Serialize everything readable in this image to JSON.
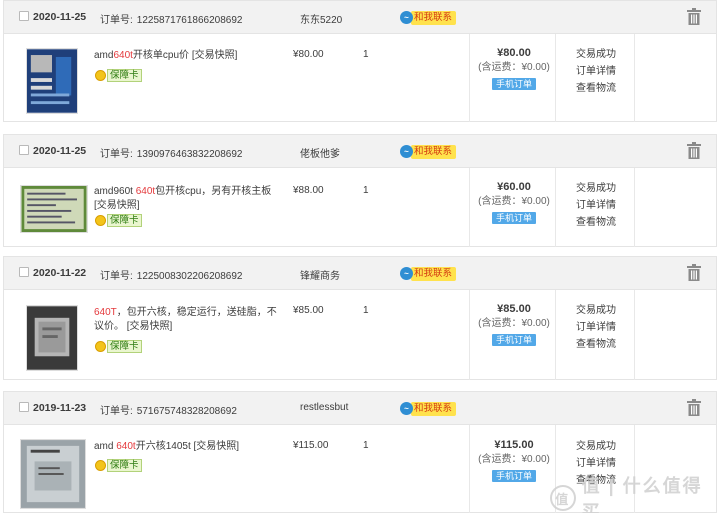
{
  "orders": [
    {
      "date": "2020-11-25",
      "order_label": "订单号:",
      "order_no": "1225871761866208692",
      "shop": "东东5220",
      "contact": "和我联系",
      "title_pre": "amd",
      "title_hl": "640t",
      "title_post": "开核单cpu价 [交易快照]",
      "badge": "保障卡",
      "price": "¥80.00",
      "qty": "1",
      "total": "¥80.00",
      "shipping": "(含运费：¥0.00)",
      "mobile": "手机订单",
      "actions": [
        "交易成功",
        "订单详情",
        "查看物流"
      ]
    },
    {
      "date": "2020-11-25",
      "order_label": "订单号:",
      "order_no": "1390976463832208692",
      "shop": "佬板他爹",
      "contact": "和我联系",
      "title_pre": "amd960t ",
      "title_hl": "640t",
      "title_post": "包开核cpu，另有开核主板 [交易快照]",
      "badge": "保障卡",
      "price": "¥88.00",
      "qty": "1",
      "total": "¥60.00",
      "shipping": "(含运费：¥0.00)",
      "mobile": "手机订单",
      "actions": [
        "交易成功",
        "订单详情",
        "查看物流"
      ]
    },
    {
      "date": "2020-11-22",
      "order_label": "订单号:",
      "order_no": "1225008302206208692",
      "shop": "锋耀商务",
      "contact": "和我联系",
      "title_pre": "",
      "title_hl": "640T",
      "title_post": "，包开六核，稳定运行，送硅脂，不议价。 [交易快照]",
      "badge": "保障卡",
      "price": "¥85.00",
      "qty": "1",
      "total": "¥85.00",
      "shipping": "(含运费：¥0.00)",
      "mobile": "手机订单",
      "actions": [
        "交易成功",
        "订单详情",
        "查看物流"
      ]
    },
    {
      "date": "2019-11-23",
      "order_label": "订单号:",
      "order_no": "571675748328208692",
      "shop": "restlessbut",
      "contact": "和我联系",
      "title_pre": "amd ",
      "title_hl": "640t",
      "title_post": "开六核1405t [交易快照]",
      "badge": "保障卡",
      "price": "¥115.00",
      "qty": "1",
      "total": "¥115.00",
      "shipping": "(含运费：¥0.00)",
      "mobile": "手机订单",
      "actions": [
        "交易成功",
        "订单详情",
        "查看物流"
      ]
    }
  ],
  "watermark": "值 | 什么值得买",
  "colors": {
    "header_bg": "#f2f2f2",
    "highlight": "#e4393c",
    "mobile_tag": "#52a8e8",
    "contact_bg": "#ffe24d"
  }
}
